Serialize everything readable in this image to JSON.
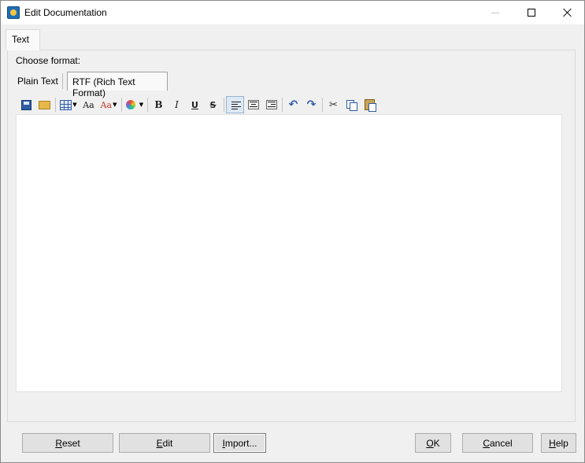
{
  "window": {
    "title": "Edit Documentation",
    "app_icon": "app-icon"
  },
  "tabs": {
    "outer": [
      {
        "label": "Text",
        "selected": true
      }
    ]
  },
  "format": {
    "label": "Choose format:",
    "options": [
      {
        "label": "Plain Text",
        "selected": false
      },
      {
        "label": "RTF (Rich Text Format)",
        "selected": true
      }
    ]
  },
  "toolbar": {
    "items": [
      {
        "name": "save-icon"
      },
      {
        "name": "open-folder-icon"
      },
      {
        "name": "insert-table-icon"
      },
      {
        "name": "font-icon",
        "glyph": "Aa"
      },
      {
        "name": "font-size-icon",
        "glyph": "Aa"
      },
      {
        "name": "color-icon"
      },
      {
        "name": "bold-icon",
        "glyph": "B"
      },
      {
        "name": "italic-icon",
        "glyph": "I"
      },
      {
        "name": "underline-icon",
        "glyph": "U"
      },
      {
        "name": "strikethrough-icon",
        "glyph": "S"
      },
      {
        "name": "align-left-icon",
        "active": true
      },
      {
        "name": "align-center-icon"
      },
      {
        "name": "align-right-icon"
      },
      {
        "name": "undo-icon",
        "glyph": "↶"
      },
      {
        "name": "redo-icon",
        "glyph": "↷"
      },
      {
        "name": "cut-icon",
        "glyph": "✂"
      },
      {
        "name": "copy-icon"
      },
      {
        "name": "paste-icon"
      }
    ]
  },
  "editor": {
    "content": ""
  },
  "buttons": {
    "reset": {
      "mn": "R",
      "rest": "eset"
    },
    "edit": {
      "mn": "E",
      "rest": "dit"
    },
    "import": {
      "mn": "I",
      "rest": "mport..."
    },
    "ok": {
      "mn": "O",
      "rest": "K"
    },
    "cancel": {
      "mn": "C",
      "rest": "ancel"
    },
    "help": {
      "mn": "H",
      "rest": "elp"
    }
  }
}
